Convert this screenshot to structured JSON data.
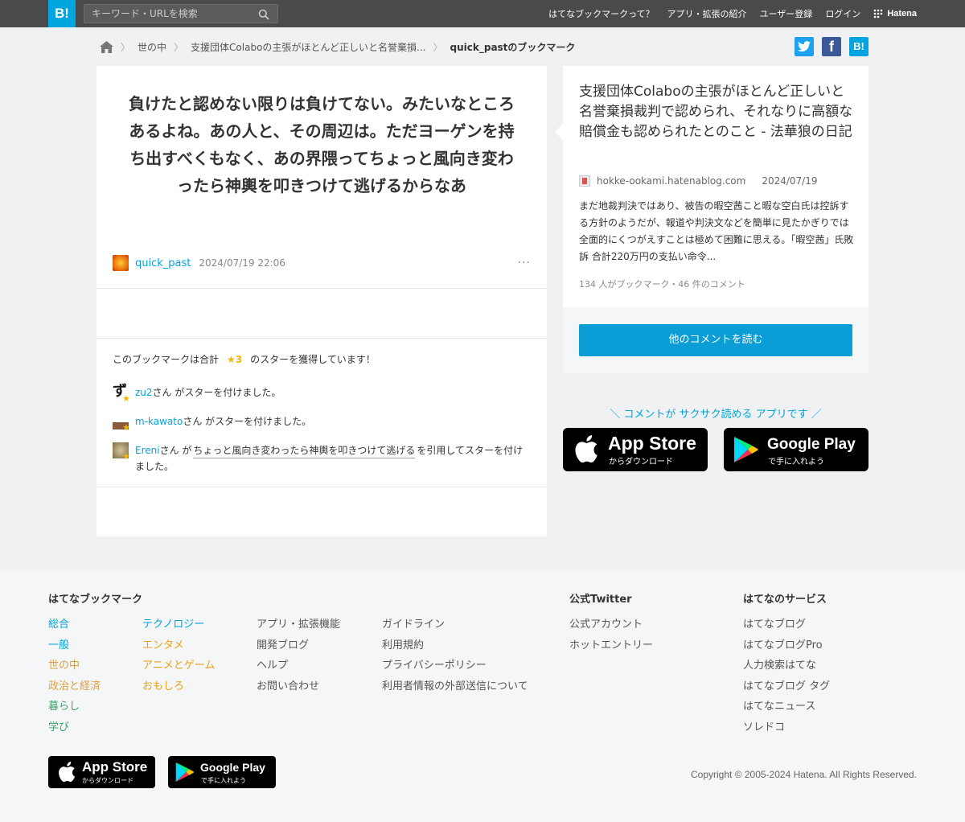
{
  "header": {
    "logo": "B!",
    "search_placeholder": "キーワード・URLを検索",
    "nav": [
      "はてなブックマークって？",
      "アプリ・拡張の紹介",
      "ユーザー登録",
      "ログイン"
    ],
    "brand": "Hatena"
  },
  "breadcrumb": {
    "items": [
      "世の中",
      "支援団体Colaboの主張がほとんど正しいと名誉棄損..."
    ],
    "current": "quick_pastのブックマーク"
  },
  "social": {
    "twitter": "t",
    "facebook": "f",
    "hatena": "B!"
  },
  "bookmark": {
    "comment": "負けたと認めない限りは負けてない。みたいなところあるよね。あの人と、その周辺は。ただヨーゲンを持ち出すべくもなく、あの界隈ってちょっと風向き変わったら神輿を叩きつけて逃げるからなあ",
    "user": "quick_past",
    "timestamp": "2024/07/19 22:06",
    "more": "···"
  },
  "stars": {
    "summary_prefix": "このブックマークは合計",
    "summary_count": "★3",
    "summary_suffix": "のスターを獲得しています！",
    "entries": [
      {
        "user": "zu2",
        "text": "さん がスターを付けました。"
      },
      {
        "user": "m-kawato",
        "text": "さん がスターを付けました。"
      },
      {
        "user": "Ereni",
        "text_before": "さん が",
        "quote": "ちょっと風向き変わったら神輿を叩きつけて逃げる",
        "text_after": "を引用してスターを付けました。"
      }
    ]
  },
  "article": {
    "title": "支援団体Colaboの主張がほとんど正しいと名誉棄損裁判で認められ、それなりに高額な賠償金も認められたとのこと - 法華狼の日記",
    "domain": "hokke-ookami.hatenablog.com",
    "date": "2024/07/19",
    "description": "まだ地裁判決ではあり、被告の暇空茜こと暇な空白氏は控訴する方針のようだが、報道や判決文などを簡単に見たかぎりでは全面的にくつがえすことは極めて困難に思える。「暇空茜」氏敗訴 合計220万円の支払い命令...",
    "stats": "134 人がブックマーク・46 件のコメント",
    "read_button": "他のコメントを読む"
  },
  "apps": {
    "caption": "＼ コメントが サクサク読める アプリです ／",
    "appstore_name": "App Store",
    "appstore_sub": "からダウンロード",
    "googleplay_name": "Google Play",
    "googleplay_sub": "で手に入れよう"
  },
  "footer": {
    "col1_title": "はてなブックマーク",
    "col1a": [
      "総合",
      "一般",
      "世の中",
      "政治と経済",
      "暮らし",
      "学び"
    ],
    "col1b": [
      "テクノロジー",
      "エンタメ",
      "アニメとゲーム",
      "おもしろ"
    ],
    "col2": [
      "アプリ・拡張機能",
      "開発ブログ",
      "ヘルプ",
      "お問い合わせ"
    ],
    "col3": [
      "ガイドライン",
      "利用規約",
      "プライバシーポリシー",
      "利用者情報の外部送信について"
    ],
    "twitter_title": "公式Twitter",
    "twitter_links": [
      "公式アカウント",
      "ホットエントリー"
    ],
    "services_title": "はてなのサービス",
    "services_links": [
      "はてなブログ",
      "はてなブログPro",
      "人力検索はてな",
      "はてなブログ タグ",
      "はてなニュース",
      "ソレドコ"
    ],
    "copyright": "Copyright © 2005-2024 Hatena. All Rights Reserved."
  },
  "colors": {
    "accent": "#00a4de",
    "header_bg": "#4a4a4a",
    "star": "#f5b800",
    "cat_general": "#00a4de",
    "cat_society": "#d9a040",
    "cat_life": "#3aa36b"
  }
}
